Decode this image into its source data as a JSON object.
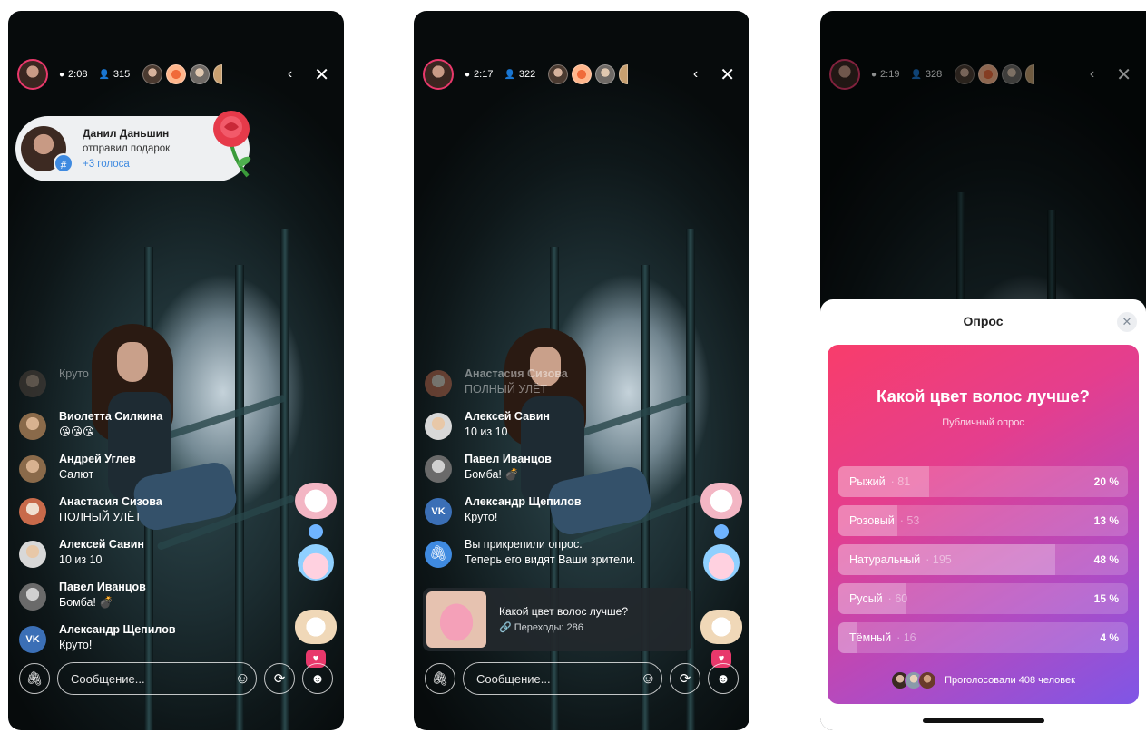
{
  "screens": [
    {
      "topbar": {
        "time": "2:08",
        "viewers": "315"
      },
      "gift": {
        "name": "Данил Даньшин",
        "action": "отправил подарок",
        "votes": "+3 голоса"
      },
      "chat": [
        {
          "name": "",
          "text": "Круто"
        },
        {
          "name": "Виолетта Силкина",
          "text": "😘😘😘"
        },
        {
          "name": "Андрей Углев",
          "text": "Салют"
        },
        {
          "name": "Анастасия Сизова",
          "text": "ПОЛНЫЙ УЛЁТ"
        },
        {
          "name": "Алексей Савин",
          "text": "10 из 10"
        },
        {
          "name": "Павел Иванцов",
          "text": "Бомба! 💣"
        },
        {
          "name": "Александр Щепилов",
          "text": "Круто!"
        }
      ],
      "input": {
        "placeholder": "Сообщение..."
      }
    },
    {
      "topbar": {
        "time": "2:17",
        "viewers": "322"
      },
      "chat": [
        {
          "name": "Анастасия Сизова",
          "text": "ПОЛНЫЙ УЛЁТ"
        },
        {
          "name": "Алексей Савин",
          "text": "10 из 10"
        },
        {
          "name": "Павел Иванцов",
          "text": "Бомба! 💣"
        },
        {
          "name": "Александр Щепилов",
          "text": "Круто!"
        },
        {
          "name": "Вы прикрепили опрос.",
          "text": "Теперь его видят Ваши зрители."
        }
      ],
      "poll_card": {
        "question": "Какой цвет волос лучше?",
        "links": "Переходы: 286"
      },
      "input": {
        "placeholder": "Сообщение..."
      }
    },
    {
      "topbar": {
        "time": "2:19",
        "viewers": "328"
      },
      "sheet": {
        "title": "Опрос",
        "question": "Какой цвет волос лучше?",
        "subtitle": "Публичный опрос",
        "options": [
          {
            "label": "Рыжий",
            "count": "81",
            "percent": "20 %",
            "fraction": 0.2
          },
          {
            "label": "Розовый",
            "count": "53",
            "percent": "13 %",
            "fraction": 0.13
          },
          {
            "label": "Натуральный",
            "count": "195",
            "percent": "48 %",
            "fraction": 0.48
          },
          {
            "label": "Русый",
            "count": "60",
            "percent": "15 %",
            "fraction": 0.15
          },
          {
            "label": "Тёмный",
            "count": "16",
            "percent": "4 %",
            "fraction": 0.04
          }
        ],
        "voted": "Проголосовали 408 человек"
      }
    }
  ],
  "icons": {
    "time": "clock-icon",
    "viewers": "person-icon",
    "back": "chevron-left-icon",
    "close": "close-icon",
    "attach": "paperclip-icon",
    "emoji": "smile-icon",
    "flip": "refresh-icon",
    "mask": "mask-icon"
  },
  "colors": {
    "accent": "#3f8ae0",
    "live_ring": "#e8386b",
    "poll_start": "#f83d6b",
    "poll_end": "#7f56e6"
  }
}
